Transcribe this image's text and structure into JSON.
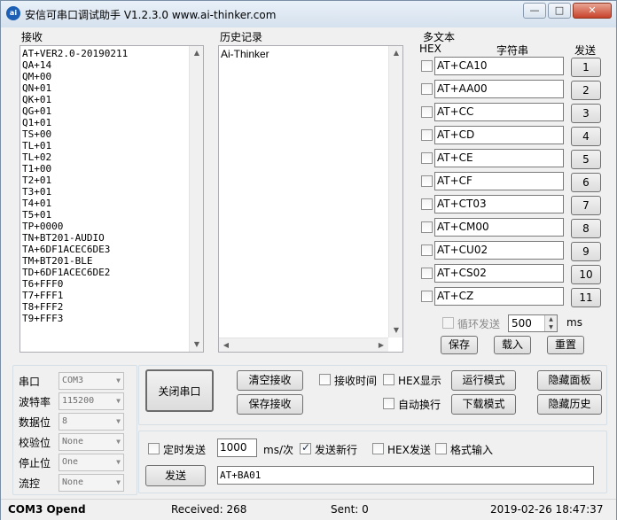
{
  "window": {
    "app_icon": "ai-thinker-logo",
    "title": "安信可串口调试助手 V1.2.3.0     www.ai-thinker.com",
    "minimize_symbol": "—",
    "maximize_symbol": "□",
    "close_symbol": "✕"
  },
  "receive": {
    "label": "接收",
    "lines": [
      "AT+VER2.0-20190211",
      "QA+14",
      "QM+00",
      "QN+01",
      "QK+01",
      "QG+01",
      "Q1+01",
      "TS+00",
      "TL+01",
      "TL+02",
      "T1+00",
      "T2+01",
      "T3+01",
      "T4+01",
      "T5+01",
      "TP+0000",
      "TN+BT201-AUDIO",
      "TA+6DF1ACEC6DE3",
      "TM+BT201-BLE",
      "TD+6DF1ACEC6DE2",
      "T6+FFF0",
      "T7+FFF1",
      "T8+FFF2",
      "T9+FFF3"
    ]
  },
  "history": {
    "label": "历史记录",
    "items": [
      "Ai-Thinker"
    ]
  },
  "multi": {
    "label": "多文本",
    "col_hex": "HEX",
    "col_string": "字符串",
    "col_send": "发送",
    "rows": [
      {
        "text": "AT+CA10",
        "num": "1"
      },
      {
        "text": "AT+AA00",
        "num": "2"
      },
      {
        "text": "AT+CC",
        "num": "3"
      },
      {
        "text": "AT+CD",
        "num": "4"
      },
      {
        "text": "AT+CE",
        "num": "5"
      },
      {
        "text": "AT+CF",
        "num": "6"
      },
      {
        "text": "AT+CT03",
        "num": "7"
      },
      {
        "text": "AT+CM00",
        "num": "8"
      },
      {
        "text": "AT+CU02",
        "num": "9"
      },
      {
        "text": "AT+CS02",
        "num": "10"
      },
      {
        "text": "AT+CZ",
        "num": "11"
      }
    ],
    "loop_label": "循环发送",
    "loop_value": "500",
    "loop_unit": "ms",
    "save": "保存",
    "load": "载入",
    "reset": "重置"
  },
  "serial": {
    "rows": [
      {
        "label": "串口",
        "value": "COM3"
      },
      {
        "label": "波特率",
        "value": "115200"
      },
      {
        "label": "数据位",
        "value": "8"
      },
      {
        "label": "校验位",
        "value": "None"
      },
      {
        "label": "停止位",
        "value": "One"
      },
      {
        "label": "流控",
        "value": "None"
      }
    ]
  },
  "controls": {
    "close_port": "关闭串口",
    "clear_recv": "清空接收",
    "save_recv": "保存接收",
    "recv_time": "接收时间",
    "hex_display": "HEX显示",
    "auto_wrap": "自动换行",
    "run_mode": "运行模式",
    "download_mode": "下载模式",
    "hide_panel": "隐藏面板",
    "hide_history": "隐藏历史"
  },
  "send": {
    "timed_send": "定时发送",
    "interval": "1000",
    "interval_unit": "ms/次",
    "send_newline": "发送新行",
    "hex_send": "HEX发送",
    "format_input": "格式输入",
    "send_button": "发送",
    "input_value": "AT+BA01"
  },
  "status": {
    "port_state": "COM3 Opend",
    "received": "Received: 268",
    "sent": "Sent: 0",
    "datetime": "2019-02-26 18:47:37"
  }
}
